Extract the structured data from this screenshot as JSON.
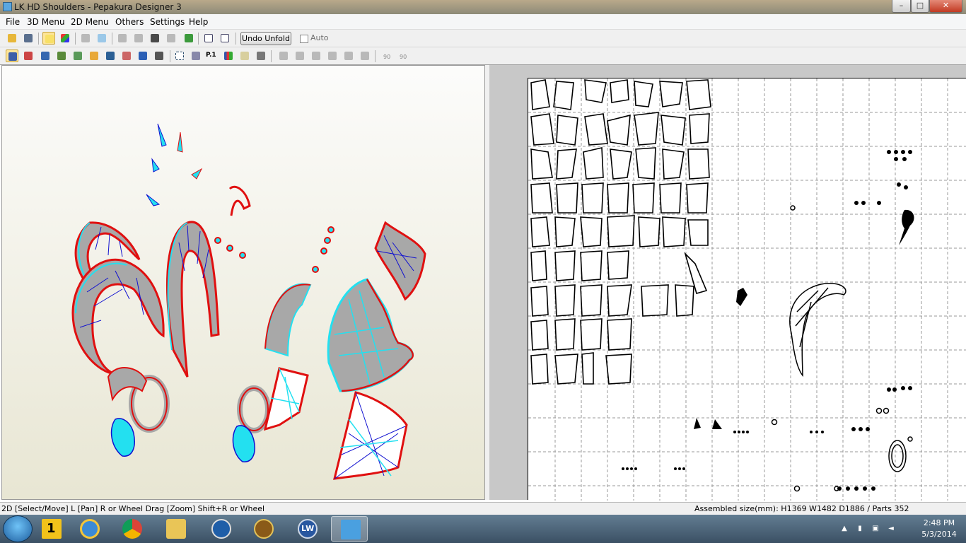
{
  "window": {
    "title": "LK HD Shoulders - Pepakura Designer 3",
    "min_glyph": "–",
    "max_glyph": "□",
    "close_glyph": "✕"
  },
  "menu": {
    "items": [
      "File",
      "3D Menu",
      "2D Menu",
      "Others",
      "Settings",
      "Help"
    ]
  },
  "toolbar": {
    "undo_unfold_label": "Undo Unfold",
    "auto_label": "Auto",
    "auto_checked": false
  },
  "toolbar2": {
    "rotate_left_label": "90",
    "rotate_right_label": "90",
    "page_label": "P.1"
  },
  "status": {
    "left": "2D [Select/Move] L [Pan] R or Wheel Drag [Zoom] Shift+R or Wheel",
    "right": "Assembled size(mm): H1369 W1482 D1886 / Parts 352"
  },
  "taskbar": {
    "apps": [
      "Windows Explorer start",
      "1",
      "Internet Explorer",
      "Google Chrome",
      "File Explorer",
      "HP",
      "World of Warcraft",
      "LightWave",
      "Pepakura Designer"
    ],
    "pinned_badge": "1",
    "lightwave_label": "LW",
    "time": "2:48 PM",
    "date": "5/3/2014"
  },
  "colors": {
    "outline_red": "#e01010",
    "fold_blue": "#1010d0",
    "edge_cyan": "#23e0f0",
    "face_gray": "#a8a8a8",
    "accent_select": "#fde59a"
  }
}
